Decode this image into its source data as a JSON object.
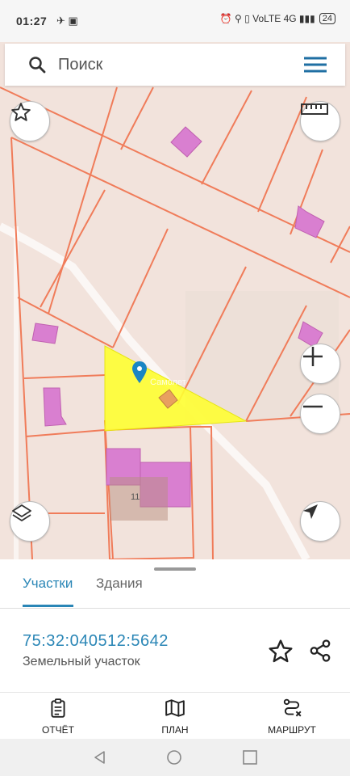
{
  "status_bar": {
    "time": "01:27",
    "left_icons": "✈ ▣",
    "right_icons": "⏰ ⚲ ▯ VoLTE 4G ▮▮▮",
    "battery": "24"
  },
  "search": {
    "placeholder": "Поиск"
  },
  "map": {
    "parcel_label": "11",
    "watermark": "Самолет"
  },
  "panel": {
    "tabs": [
      "Участки",
      "Здания"
    ],
    "parcel_number": "75:32:040512:5642",
    "parcel_type": "Земельный участок"
  },
  "bottom_nav": [
    "ОТЧЁТ",
    "ПЛАН",
    "МАРШРУТ"
  ],
  "colors": {
    "accent": "#2a86b6",
    "parcel_line": "#f07c5a",
    "building": "#d97fd0",
    "selection": "#ffff33"
  }
}
